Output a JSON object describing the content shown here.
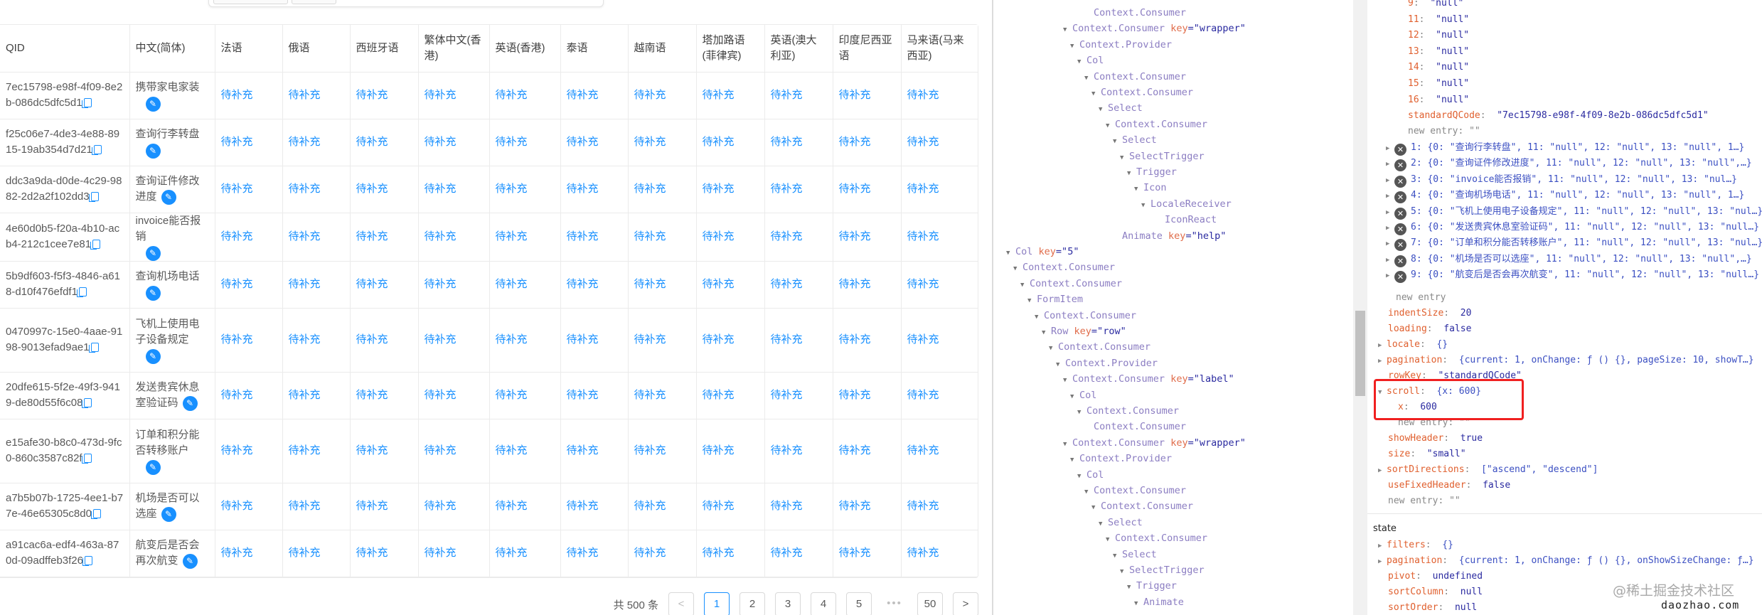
{
  "table": {
    "columns": [
      "QID",
      "中文(简体)",
      "法语",
      "俄语",
      "西班牙语",
      "繁体中文(香港)",
      "英语(香港)",
      "泰语",
      "越南语",
      "塔加路语(菲律宾)",
      "英语(澳大利亚)",
      "印度尼西亚语",
      "马来语(马来西亚)"
    ],
    "pending_label": "待补充",
    "rows": [
      {
        "qid": "7ec15798-e98f-4f09-8e2b-086dc5dfc5d1",
        "zh": "携带家电家装"
      },
      {
        "qid": "f25c06e7-4de3-4e88-8915-19ab354d7d21",
        "zh": "查询行李转盘"
      },
      {
        "qid": "ddc3a9da-d0de-4c29-9882-2d2a2f102dd3",
        "zh": "查询证件修改进度"
      },
      {
        "qid": "4e60d0b5-f20a-4b10-acb4-212c1cee7e81",
        "zh": "invoice能否报销"
      },
      {
        "qid": "5b9df603-f5f3-4846-a618-d10f476efdf1",
        "zh": "查询机场电话"
      },
      {
        "qid": "0470997c-15e0-4aae-9198-9013efad9ae1",
        "zh": "飞机上使用电子设备规定"
      },
      {
        "qid": "20dfe615-5f2e-49f3-9419-de80d55f6c08",
        "zh": "发送贵宾休息室验证码"
      },
      {
        "qid": "e15afe30-b8c0-473d-9fc0-860c3587c82f",
        "zh": "订单和积分能否转移账户"
      },
      {
        "qid": "a7b5b07b-1725-4ee1-b77e-46e65305c8d0",
        "zh": "机场是否可以选座"
      },
      {
        "qid": "a91cac6a-edf4-463a-870d-09adffeb3f26",
        "zh": "航变后是否会再次航变"
      }
    ]
  },
  "pagination": {
    "total_label": "共 500 条",
    "prev": "<",
    "pages": [
      "1",
      "2",
      "3",
      "4",
      "5"
    ],
    "ellipsis": "•••",
    "last": "50",
    "next": ">",
    "current": "1"
  },
  "devtools": {
    "tree": [
      {
        "indent": 13,
        "arrow": false,
        "name": "Context.Consumer"
      },
      {
        "indent": 10,
        "arrow": true,
        "name": "Context.Consumer",
        "key": "wrapper"
      },
      {
        "indent": 11,
        "arrow": true,
        "name": "Context.Provider"
      },
      {
        "indent": 12,
        "arrow": true,
        "name": "Col"
      },
      {
        "indent": 13,
        "arrow": true,
        "name": "Context.Consumer"
      },
      {
        "indent": 14,
        "arrow": true,
        "name": "Context.Consumer"
      },
      {
        "indent": 15,
        "arrow": true,
        "name": "Select"
      },
      {
        "indent": 16,
        "arrow": true,
        "name": "Context.Consumer"
      },
      {
        "indent": 17,
        "arrow": true,
        "name": "Select"
      },
      {
        "indent": 18,
        "arrow": true,
        "name": "SelectTrigger"
      },
      {
        "indent": 19,
        "arrow": true,
        "name": "Trigger"
      },
      {
        "indent": 20,
        "arrow": true,
        "name": "Icon"
      },
      {
        "indent": 21,
        "arrow": true,
        "name": "LocaleReceiver"
      },
      {
        "indent": 23,
        "arrow": false,
        "name": "IconReact"
      },
      {
        "indent": 17,
        "arrow": false,
        "name": "Animate",
        "key": "help"
      },
      {
        "indent": 2,
        "arrow": true,
        "name": "Col",
        "key": "5"
      },
      {
        "indent": 3,
        "arrow": true,
        "name": "Context.Consumer"
      },
      {
        "indent": 4,
        "arrow": true,
        "name": "Context.Consumer"
      },
      {
        "indent": 5,
        "arrow": true,
        "name": "FormItem"
      },
      {
        "indent": 6,
        "arrow": true,
        "name": "Context.Consumer"
      },
      {
        "indent": 7,
        "arrow": true,
        "name": "Row",
        "key": "row"
      },
      {
        "indent": 8,
        "arrow": true,
        "name": "Context.Consumer"
      },
      {
        "indent": 9,
        "arrow": true,
        "name": "Context.Provider"
      },
      {
        "indent": 10,
        "arrow": true,
        "name": "Context.Consumer",
        "key": "label"
      },
      {
        "indent": 11,
        "arrow": true,
        "name": "Col"
      },
      {
        "indent": 12,
        "arrow": true,
        "name": "Context.Consumer"
      },
      {
        "indent": 13,
        "arrow": false,
        "name": "Context.Consumer"
      },
      {
        "indent": 10,
        "arrow": true,
        "name": "Context.Consumer",
        "key": "wrapper"
      },
      {
        "indent": 11,
        "arrow": true,
        "name": "Context.Provider"
      },
      {
        "indent": 12,
        "arrow": true,
        "name": "Col"
      },
      {
        "indent": 13,
        "arrow": true,
        "name": "Context.Consumer"
      },
      {
        "indent": 14,
        "arrow": true,
        "name": "Context.Consumer"
      },
      {
        "indent": 15,
        "arrow": true,
        "name": "Select"
      },
      {
        "indent": 16,
        "arrow": true,
        "name": "Context.Consumer"
      },
      {
        "indent": 17,
        "arrow": true,
        "name": "Select"
      },
      {
        "indent": 18,
        "arrow": true,
        "name": "SelectTrigger"
      },
      {
        "indent": 19,
        "arrow": true,
        "name": "Trigger"
      },
      {
        "indent": 20,
        "arrow": true,
        "name": "Animate"
      }
    ],
    "props": {
      "null_entries": [
        {
          "k": "9",
          "v": "\"null\""
        },
        {
          "k": "11",
          "v": "\"null\""
        },
        {
          "k": "12",
          "v": "\"null\""
        },
        {
          "k": "13",
          "v": "\"null\""
        },
        {
          "k": "14",
          "v": "\"null\""
        },
        {
          "k": "15",
          "v": "\"null\""
        },
        {
          "k": "16",
          "v": "\"null\""
        }
      ],
      "standardQCode_key": "standardQCode",
      "standardQCode_val": "\"7ec15798-e98f-4f09-8e2b-086dc5dfc5d1\"",
      "new_entry_empty": "new entry: \"\"",
      "data_items": [
        "1: {0: \"查询行李转盘\", 11: \"null\", 12: \"null\", 13: \"null\", 1…}",
        "2: {0: \"查询证件修改进度\", 11: \"null\", 12: \"null\", 13: \"null\",…}",
        "3: {0: \"invoice能否报销\", 11: \"null\", 12: \"null\", 13: \"nul…}",
        "4: {0: \"查询机场电话\", 11: \"null\", 12: \"null\", 13: \"null\", 1…}",
        "5: {0: \"飞机上使用电子设备规定\", 11: \"null\", 12: \"null\", 13: \"nul…}",
        "6: {0: \"发送贵宾休息室验证码\", 11: \"null\", 12: \"null\", 13: \"null…}",
        "7: {0: \"订单和积分能否转移账户\", 11: \"null\", 12: \"null\", 13: \"nul…}",
        "8: {0: \"机场是否可以选座\", 11: \"null\", 12: \"null\", 13: \"null\",…}",
        "9: {0: \"航变后是否会再次航变\", 11: \"null\", 12: \"null\", 13: \"null…}"
      ],
      "new_entry": "new entry",
      "indentSize_key": "indentSize",
      "indentSize_val": "20",
      "loading_key": "loading",
      "loading_val": "false",
      "locale_key": "locale",
      "locale_val": "{}",
      "pagination_key": "pagination",
      "pagination_val": "{current: 1, onChange: ƒ () {}, pageSize: 10, showT…}",
      "rowKey_key": "rowKey",
      "rowKey_val": "\"standardQCode\"",
      "scroll_key": "scroll",
      "scroll_val": "{x: 600}",
      "scroll_x_key": "x",
      "scroll_x_val": "600",
      "showHeader_key": "showHeader",
      "showHeader_val": "true",
      "size_key": "size",
      "size_val": "\"small\"",
      "sortDirections_key": "sortDirections",
      "sortDirections_val": "[\"ascend\", \"descend\"]",
      "useFixedHeader_key": "useFixedHeader",
      "useFixedHeader_val": "false"
    },
    "state": {
      "label": "state",
      "filters_key": "filters",
      "filters_val": "{}",
      "pagination_key": "pagination",
      "pagination_val": "{current: 1, onChange: ƒ () {}, onShowSizeChange: ƒ…}",
      "pivot_key": "pivot",
      "pivot_val": "undefined",
      "sortColumn_key": "sortColumn",
      "sortColumn_val": "null",
      "sortOrder_key": "sortOrder",
      "sortOrder_val": "null"
    }
  },
  "watermark": {
    "community": "@稀土掘金技术社区",
    "site": "daozhao.com"
  },
  "colors": {
    "accent": "#1890ff",
    "highlight": "#f02020",
    "prop_key": "#e0602f",
    "prop_value": "#2a2aa0",
    "tree_node": "#8b7dc2"
  }
}
